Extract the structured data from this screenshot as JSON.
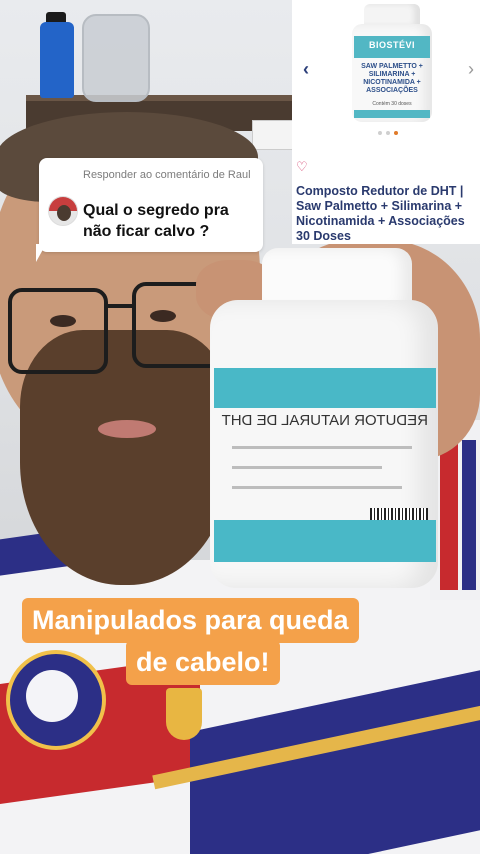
{
  "comment": {
    "reply_prefix": "Responder ao comentário de Raul",
    "text": "Qual o segredo pra não ficar calvo ?"
  },
  "product_card": {
    "title": "Composto Redutor de DHT | Saw Palmetto + Silimarina + Nicotinamida + Associações 30 Doses",
    "image": {
      "brand": "BIOSTÉVI",
      "label_text": "SAW PALMETTO + SILIMARINA + NICOTINAMIDA + ASSOCIAÇÕES",
      "small_text": "Contém 30 doses"
    },
    "carousel_dots": 3,
    "active_dot": 2
  },
  "held_bottle": {
    "label": "REDUTOR NATURAL DE DHT"
  },
  "caption": {
    "line1": "Manipulados para queda",
    "line2": "de cabelo!"
  },
  "colors": {
    "caption_bg": "#f4a14a",
    "card_title": "#2a3a6e",
    "bottle_band": "#49b8c7",
    "active_dot": "#e07b2a"
  }
}
